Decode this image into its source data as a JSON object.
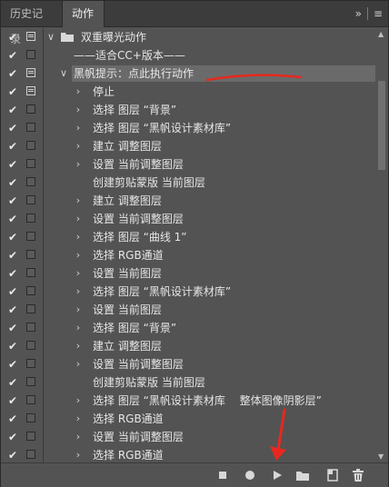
{
  "tabs": {
    "history": "历史记录",
    "actions": "动作"
  },
  "toolbar": {
    "collapse_icon": "double-chevron-right-icon",
    "menu_icon": "hamburger-menu-icon"
  },
  "rows": [
    {
      "check": true,
      "dialog": true,
      "expanded": true,
      "kind": "set",
      "label": "双重曝光动作"
    },
    {
      "check": true,
      "dialog": false,
      "kind": "action",
      "label": "——适合CC+版本——"
    },
    {
      "check": true,
      "dialog": true,
      "expanded": true,
      "kind": "action",
      "label": "黑帆提示：点此执行动作",
      "selected": true
    },
    {
      "check": true,
      "dialog": true,
      "expandable": true,
      "kind": "step",
      "label": "停止"
    },
    {
      "check": true,
      "dialog": false,
      "expandable": true,
      "kind": "step",
      "label": "选择 图层 “背景”"
    },
    {
      "check": true,
      "dialog": false,
      "expandable": true,
      "kind": "step",
      "label": "选择 图层 “黑帆设计素材库”"
    },
    {
      "check": true,
      "dialog": false,
      "expandable": true,
      "kind": "step",
      "label": "建立 调整图层"
    },
    {
      "check": true,
      "dialog": false,
      "expandable": true,
      "kind": "step",
      "label": "设置 当前调整图层"
    },
    {
      "check": true,
      "dialog": false,
      "expandable": false,
      "kind": "step",
      "label": "创建剪贴蒙版 当前图层"
    },
    {
      "check": true,
      "dialog": false,
      "expandable": true,
      "kind": "step",
      "label": "建立 调整图层"
    },
    {
      "check": true,
      "dialog": false,
      "expandable": true,
      "kind": "step",
      "label": "设置 当前调整图层"
    },
    {
      "check": true,
      "dialog": false,
      "expandable": true,
      "kind": "step",
      "label": "选择 图层 “曲线 1”"
    },
    {
      "check": true,
      "dialog": false,
      "expandable": true,
      "kind": "step",
      "label": "选择 RGB通道"
    },
    {
      "check": true,
      "dialog": false,
      "expandable": true,
      "kind": "step",
      "label": "设置 当前图层"
    },
    {
      "check": true,
      "dialog": false,
      "expandable": true,
      "kind": "step",
      "label": "选择 图层 “黑帆设计素材库”"
    },
    {
      "check": true,
      "dialog": false,
      "expandable": true,
      "kind": "step",
      "label": "设置 当前图层"
    },
    {
      "check": true,
      "dialog": false,
      "expandable": true,
      "kind": "step",
      "label": "选择 图层 “背景”"
    },
    {
      "check": true,
      "dialog": false,
      "expandable": true,
      "kind": "step",
      "label": "建立 调整图层"
    },
    {
      "check": true,
      "dialog": false,
      "expandable": true,
      "kind": "step",
      "label": "设置 当前调整图层"
    },
    {
      "check": true,
      "dialog": false,
      "expandable": false,
      "kind": "step",
      "label": "创建剪贴蒙版 当前图层"
    },
    {
      "check": true,
      "dialog": false,
      "expandable": true,
      "kind": "step",
      "label": "选择 图层 “黑帆设计素材库　 整体图像阴影层”"
    },
    {
      "check": true,
      "dialog": false,
      "expandable": true,
      "kind": "step",
      "label": "选择 RGB通道"
    },
    {
      "check": true,
      "dialog": false,
      "expandable": true,
      "kind": "step",
      "label": "设置 当前调整图层"
    },
    {
      "check": true,
      "dialog": false,
      "expandable": true,
      "kind": "step",
      "label": "选择 RGB通道"
    }
  ],
  "footer": {
    "stop_icon": "stop-icon",
    "record_icon": "record-icon",
    "play_icon": "play-icon",
    "new_set_icon": "folder-icon",
    "new_action_icon": "new-action-icon",
    "delete_icon": "trash-icon"
  },
  "colors": {
    "panel": "#535353",
    "tabbar": "#3c3c3c",
    "selected": "#6a6a6a",
    "annotation": "#e8281e"
  }
}
